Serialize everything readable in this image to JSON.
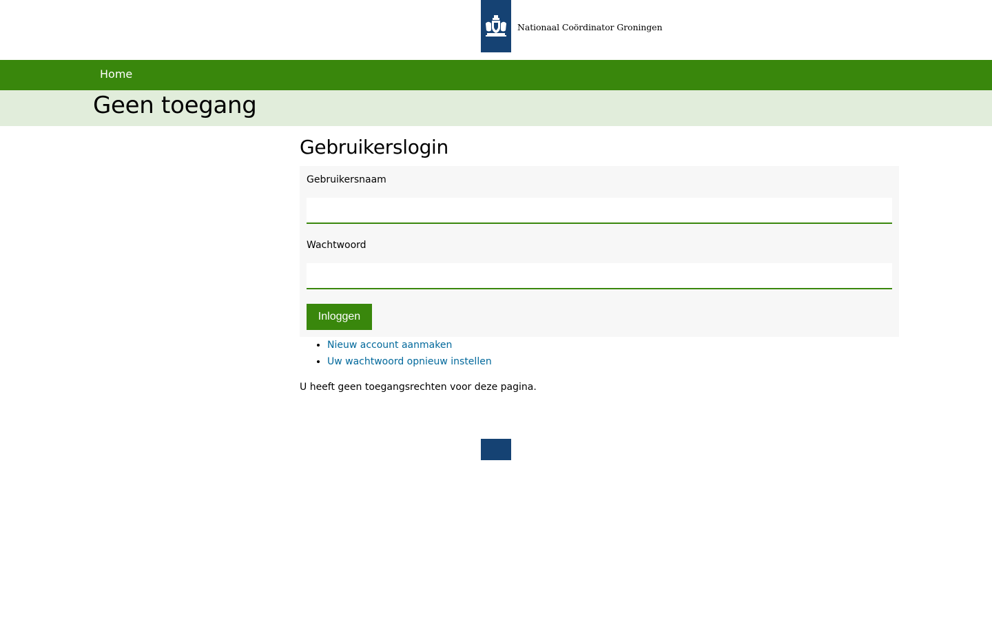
{
  "header": {
    "logo_icon": "rijksoverheid-coat-of-arms-icon",
    "organization": "Nationaal Coördinator Groningen",
    "brand_color": "#154273"
  },
  "nav": {
    "home_label": "Home",
    "color": "#39870c"
  },
  "page": {
    "title": "Geen toegang"
  },
  "login": {
    "heading": "Gebruikerslogin",
    "username_label": "Gebruikersnaam",
    "username_value": "",
    "password_label": "Wachtwoord",
    "password_value": "",
    "submit_label": "Inloggen"
  },
  "links": {
    "create_account": "Nieuw account aanmaken",
    "reset_password": "Uw wachtwoord opnieuw instellen"
  },
  "notice": "U heeft geen toegangsrechten voor deze pagina."
}
